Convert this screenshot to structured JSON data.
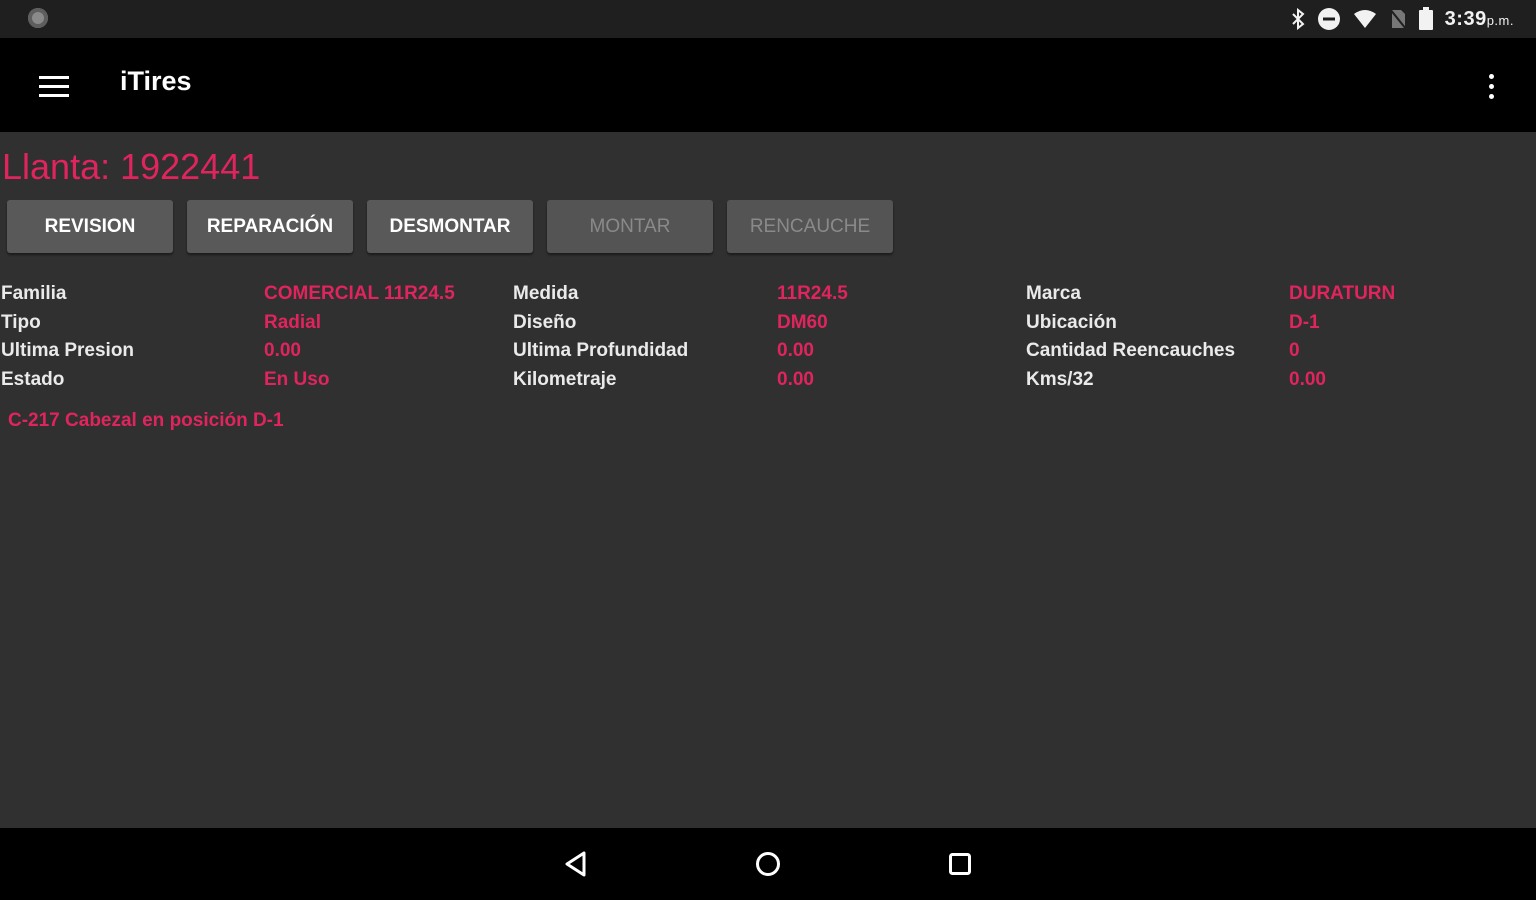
{
  "status_bar": {
    "time": "3:39",
    "ampm": "p.m."
  },
  "app_bar": {
    "title": "iTires"
  },
  "tire": {
    "title": "Llanta: 1922441"
  },
  "actions": {
    "revision": "REVISION",
    "reparacion": "REPARACIÓN",
    "desmontar": "DESMONTAR",
    "montar": "MONTAR",
    "rencauche": "RENCAUCHE"
  },
  "details": {
    "col1": [
      {
        "label": "Familia",
        "value": "COMERCIAL 11R24.5"
      },
      {
        "label": "Tipo",
        "value": "Radial"
      },
      {
        "label": "Ultima Presion",
        "value": "0.00"
      },
      {
        "label": "Estado",
        "value": "En Uso"
      }
    ],
    "col2": [
      {
        "label": "Medida",
        "value": "11R24.5"
      },
      {
        "label": "Diseño",
        "value": "DM60"
      },
      {
        "label": "Ultima Profundidad",
        "value": "0.00"
      },
      {
        "label": "Kilometraje",
        "value": "0.00"
      }
    ],
    "col3": [
      {
        "label": "Marca",
        "value": "DURATURN"
      },
      {
        "label": "Ubicación",
        "value": "D-1"
      },
      {
        "label": "Cantidad Reencauches",
        "value": "0"
      },
      {
        "label": "Kms/32",
        "value": "0.00"
      }
    ]
  },
  "location_note": "C-217 Cabezal en posición D-1",
  "colors": {
    "accent": "#e0245e",
    "background": "#303030",
    "app_bar": "#000000",
    "status_bar": "#1f1f1f",
    "button": "#595959"
  },
  "icons": {
    "status": [
      "notification-dot-icon",
      "bluetooth-icon",
      "do-not-disturb-icon",
      "wifi-icon",
      "no-sim-icon",
      "battery-icon"
    ],
    "app_bar": [
      "menu-icon",
      "more-vert-icon"
    ],
    "navigation": [
      "back-icon",
      "home-icon",
      "recents-icon"
    ]
  }
}
